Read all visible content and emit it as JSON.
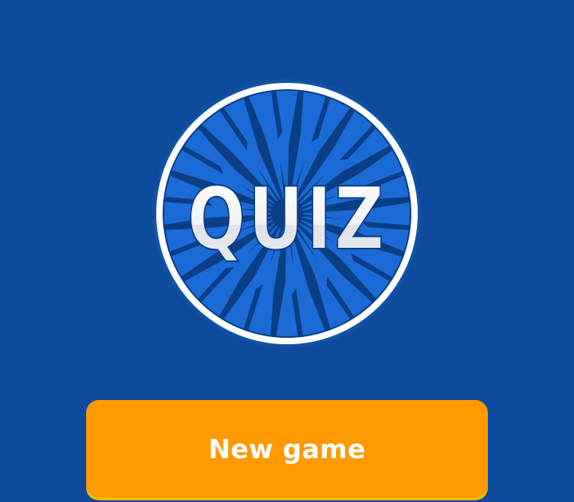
{
  "logo": {
    "text": "QUIZ",
    "icon": "quiz-burst-badge"
  },
  "menu": {
    "new_game_label": "New game"
  },
  "colors": {
    "background": "#0d4b9c",
    "badge_dark": "#0a3f86",
    "badge_ray": "#1b6ad6",
    "badge_ring": "#ffffff",
    "button": "#ff9900",
    "button_edge": "#f7b500",
    "button_text": "#ffffff"
  }
}
